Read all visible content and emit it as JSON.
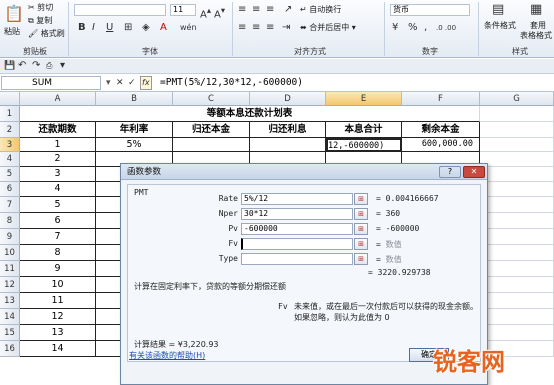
{
  "ribbon": {
    "clipboard": {
      "paste": "粘贴",
      "cut": "剪切",
      "copy": "复制",
      "format_painter": "格式刷",
      "label": "剪贴板"
    },
    "font": {
      "size": "11",
      "bold": "B",
      "italic": "I",
      "underline": "U",
      "label": "字体",
      "change_case": "A",
      "phonetic": "wén"
    },
    "alignment": {
      "wrap": "自动换行",
      "merge": "合并后居中",
      "label": "对齐方式"
    },
    "number": {
      "format": "货币",
      "label": "数字",
      "percent": "%",
      "comma": ",",
      "inc_dec": ".0 .00"
    },
    "styles": {
      "conditional": "条件格式",
      "table": "套用",
      "table2": "表格格式",
      "label": "样式"
    }
  },
  "formula_bar": {
    "name_box": "SUM",
    "cancel": "✕",
    "confirm": "✓",
    "fx": "fx",
    "formula": "=PMT(5%/12,30*12,-600000)"
  },
  "columns": [
    "A",
    "B",
    "C",
    "D",
    "E",
    "F",
    "G"
  ],
  "rows": [
    "1",
    "2",
    "3",
    "4",
    "5",
    "6",
    "7",
    "8",
    "9",
    "10",
    "11",
    "12",
    "13",
    "14",
    "15",
    "16"
  ],
  "sheet": {
    "title": "等额本息还款计划表",
    "headers": [
      "还款期数",
      "年利率",
      "归还本金",
      "归还利息",
      "本息合计",
      "剩余本金"
    ],
    "row3": {
      "period": "1",
      "rate": "5%",
      "total": "12,-600000)",
      "remaining": "600,000.00"
    },
    "periods": [
      "2",
      "3",
      "4",
      "5",
      "6",
      "7",
      "8",
      "9",
      "10",
      "11",
      "12",
      "13",
      "14"
    ]
  },
  "dialog": {
    "title": "函数参数",
    "help_btn": "?",
    "close_btn": "✕",
    "function": "PMT",
    "args": [
      {
        "name": "Rate",
        "value": "5%/12",
        "result": "0.004166667"
      },
      {
        "name": "Nper",
        "value": "30*12",
        "result": "360"
      },
      {
        "name": "Pv",
        "value": "-600000",
        "result": "-600000"
      },
      {
        "name": "Fv",
        "value": "",
        "result": "数值"
      },
      {
        "name": "Type",
        "value": "",
        "result": "数值"
      }
    ],
    "overall_result": "3220.929738",
    "description": "计算在固定利率下，贷款的等额分期偿还额",
    "fv_label": "Fv",
    "fv_desc": "未来值，或在最后一次付款后可以获得的现金余额。如果忽略，则认为此值为 0",
    "calc_result_label": "计算结果 =",
    "calc_result_value": "¥3,220.93",
    "help_link": "有关该函数的帮助(H)",
    "ok": "确定"
  },
  "watermark": {
    "text": "锐客网"
  },
  "colors": {
    "accent": "#2b579a",
    "selected_header": "#f9d99b",
    "dialog_bg": "#f0f4f9"
  }
}
